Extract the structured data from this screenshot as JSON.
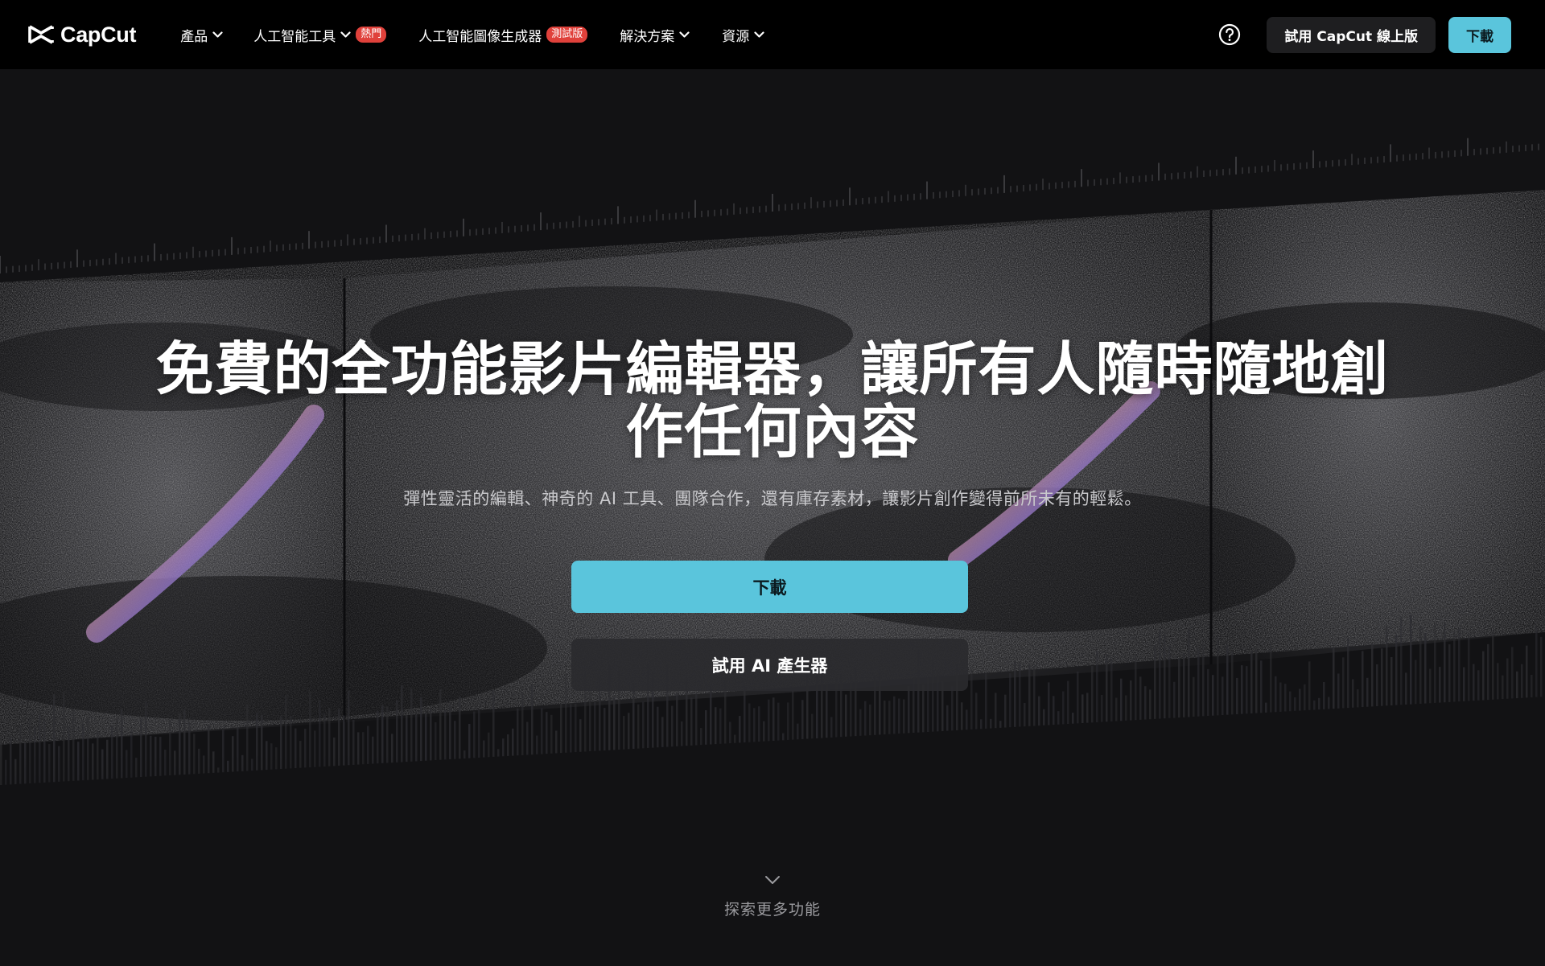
{
  "brand": {
    "name": "CapCut"
  },
  "nav": {
    "items": [
      {
        "label": "產品",
        "has_dropdown": true,
        "badge": ""
      },
      {
        "label": "人工智能工具",
        "has_dropdown": true,
        "badge": "熱門"
      },
      {
        "label": "人工智能圖像生成器",
        "has_dropdown": false,
        "badge": "測試版"
      },
      {
        "label": "解決方案",
        "has_dropdown": true,
        "badge": ""
      },
      {
        "label": "資源",
        "has_dropdown": true,
        "badge": ""
      }
    ],
    "help_icon": "question-circle-icon",
    "try_online_label": "試用 CapCut 線上版",
    "download_label": "下載"
  },
  "hero": {
    "title_line1": "免費的全功能影片編輯器，讓所有人隨時隨地創",
    "title_line2": "作任何內容",
    "subtitle": "彈性靈活的編輯、神奇的 AI 工具、團隊合作，還有庫存素材，讓影片創作變得前所未有的輕鬆。",
    "primary_button": "下載",
    "secondary_button": "試用 AI 產生器"
  },
  "explore": {
    "label": "探索更多功能",
    "icon": "chevron-down-icon"
  },
  "colors": {
    "accent": "#5ac5dc",
    "badge": "#e0413b",
    "nav_bg": "#000000",
    "page_bg": "#121214"
  }
}
